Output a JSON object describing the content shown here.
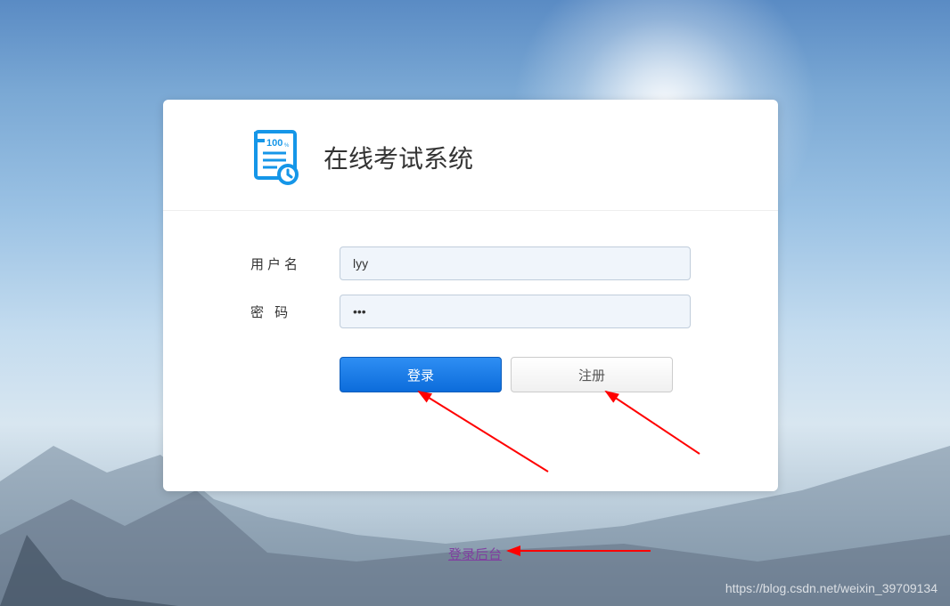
{
  "header": {
    "title": "在线考试系统"
  },
  "form": {
    "username_label": "用户名",
    "username_value": "lyy",
    "password_label": "密 码",
    "password_value": "•••"
  },
  "buttons": {
    "login_label": "登录",
    "register_label": "注册"
  },
  "links": {
    "backend_login": "登录后台"
  },
  "watermark": "https://blog.csdn.net/weixin_39709134",
  "colors": {
    "primary": "#0c6cdb",
    "link": "#8040a0"
  }
}
